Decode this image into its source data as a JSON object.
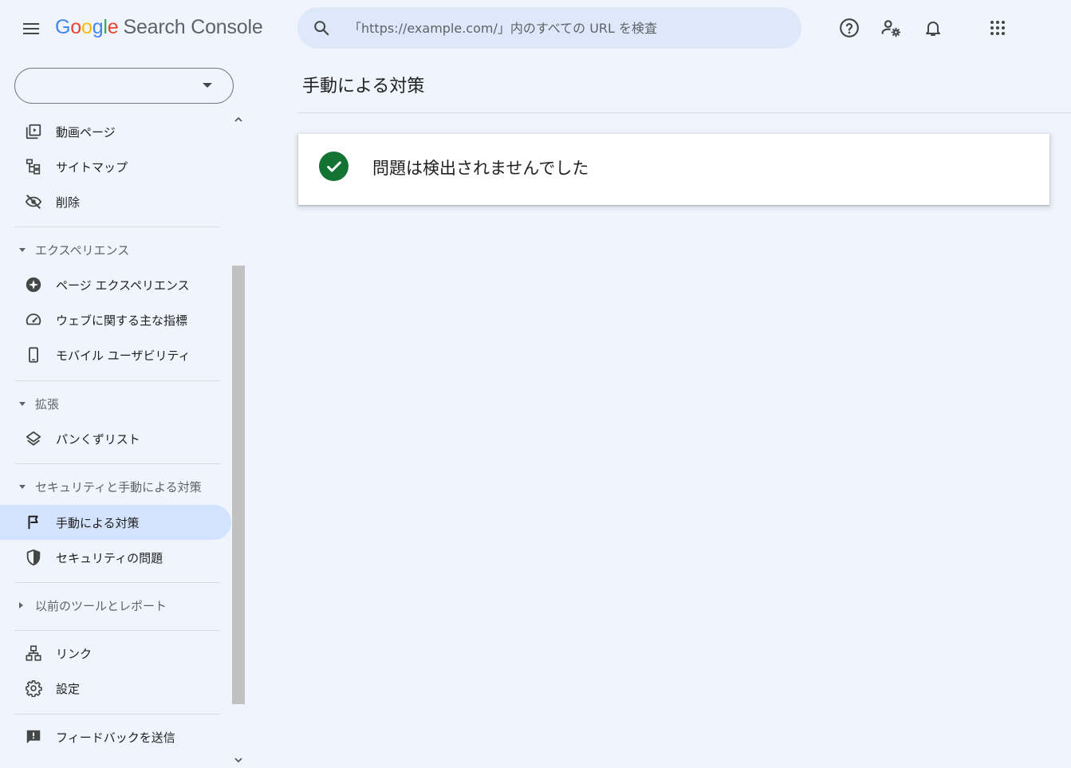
{
  "header": {
    "logo_letters": [
      "G",
      "o",
      "o",
      "g",
      "l",
      "e"
    ],
    "product_name": "Search Console",
    "search_placeholder": "「https://example.com/」内のすべての URL を検査"
  },
  "property_selector": {
    "value": ""
  },
  "sidebar": {
    "items_top": [
      {
        "label": "動画ページ",
        "icon": "video-page-icon"
      },
      {
        "label": "サイトマップ",
        "icon": "sitemap-icon"
      },
      {
        "label": "削除",
        "icon": "removal-icon"
      }
    ],
    "experience": {
      "heading": "エクスペリエンス",
      "items": [
        {
          "label": "ページ エクスペリエンス",
          "icon": "page-experience-icon"
        },
        {
          "label": "ウェブに関する主な指標",
          "icon": "speedometer-icon"
        },
        {
          "label": "モバイル ユーザビリティ",
          "icon": "mobile-icon"
        }
      ]
    },
    "enhancements": {
      "heading": "拡張",
      "items": [
        {
          "label": "パンくずリスト",
          "icon": "layers-icon"
        }
      ]
    },
    "security": {
      "heading": "セキュリティと手動による対策",
      "items": [
        {
          "label": "手動による対策",
          "icon": "flag-icon",
          "active": true
        },
        {
          "label": "セキュリティの問題",
          "icon": "shield-icon"
        }
      ]
    },
    "legacy": {
      "heading": "以前のツールとレポート"
    },
    "items_bottom": [
      {
        "label": "リンク",
        "icon": "links-icon"
      },
      {
        "label": "設定",
        "icon": "settings-icon"
      }
    ],
    "feedback": {
      "label": "フィードバックを送信",
      "icon": "feedback-icon"
    }
  },
  "main": {
    "title": "手動による対策",
    "status_message": "問題は検出されませんでした"
  },
  "colors": {
    "background": "#f0f4fc",
    "search_bg": "#dde8fb",
    "active_nav": "#d3e3fd",
    "success_green": "#137333"
  }
}
